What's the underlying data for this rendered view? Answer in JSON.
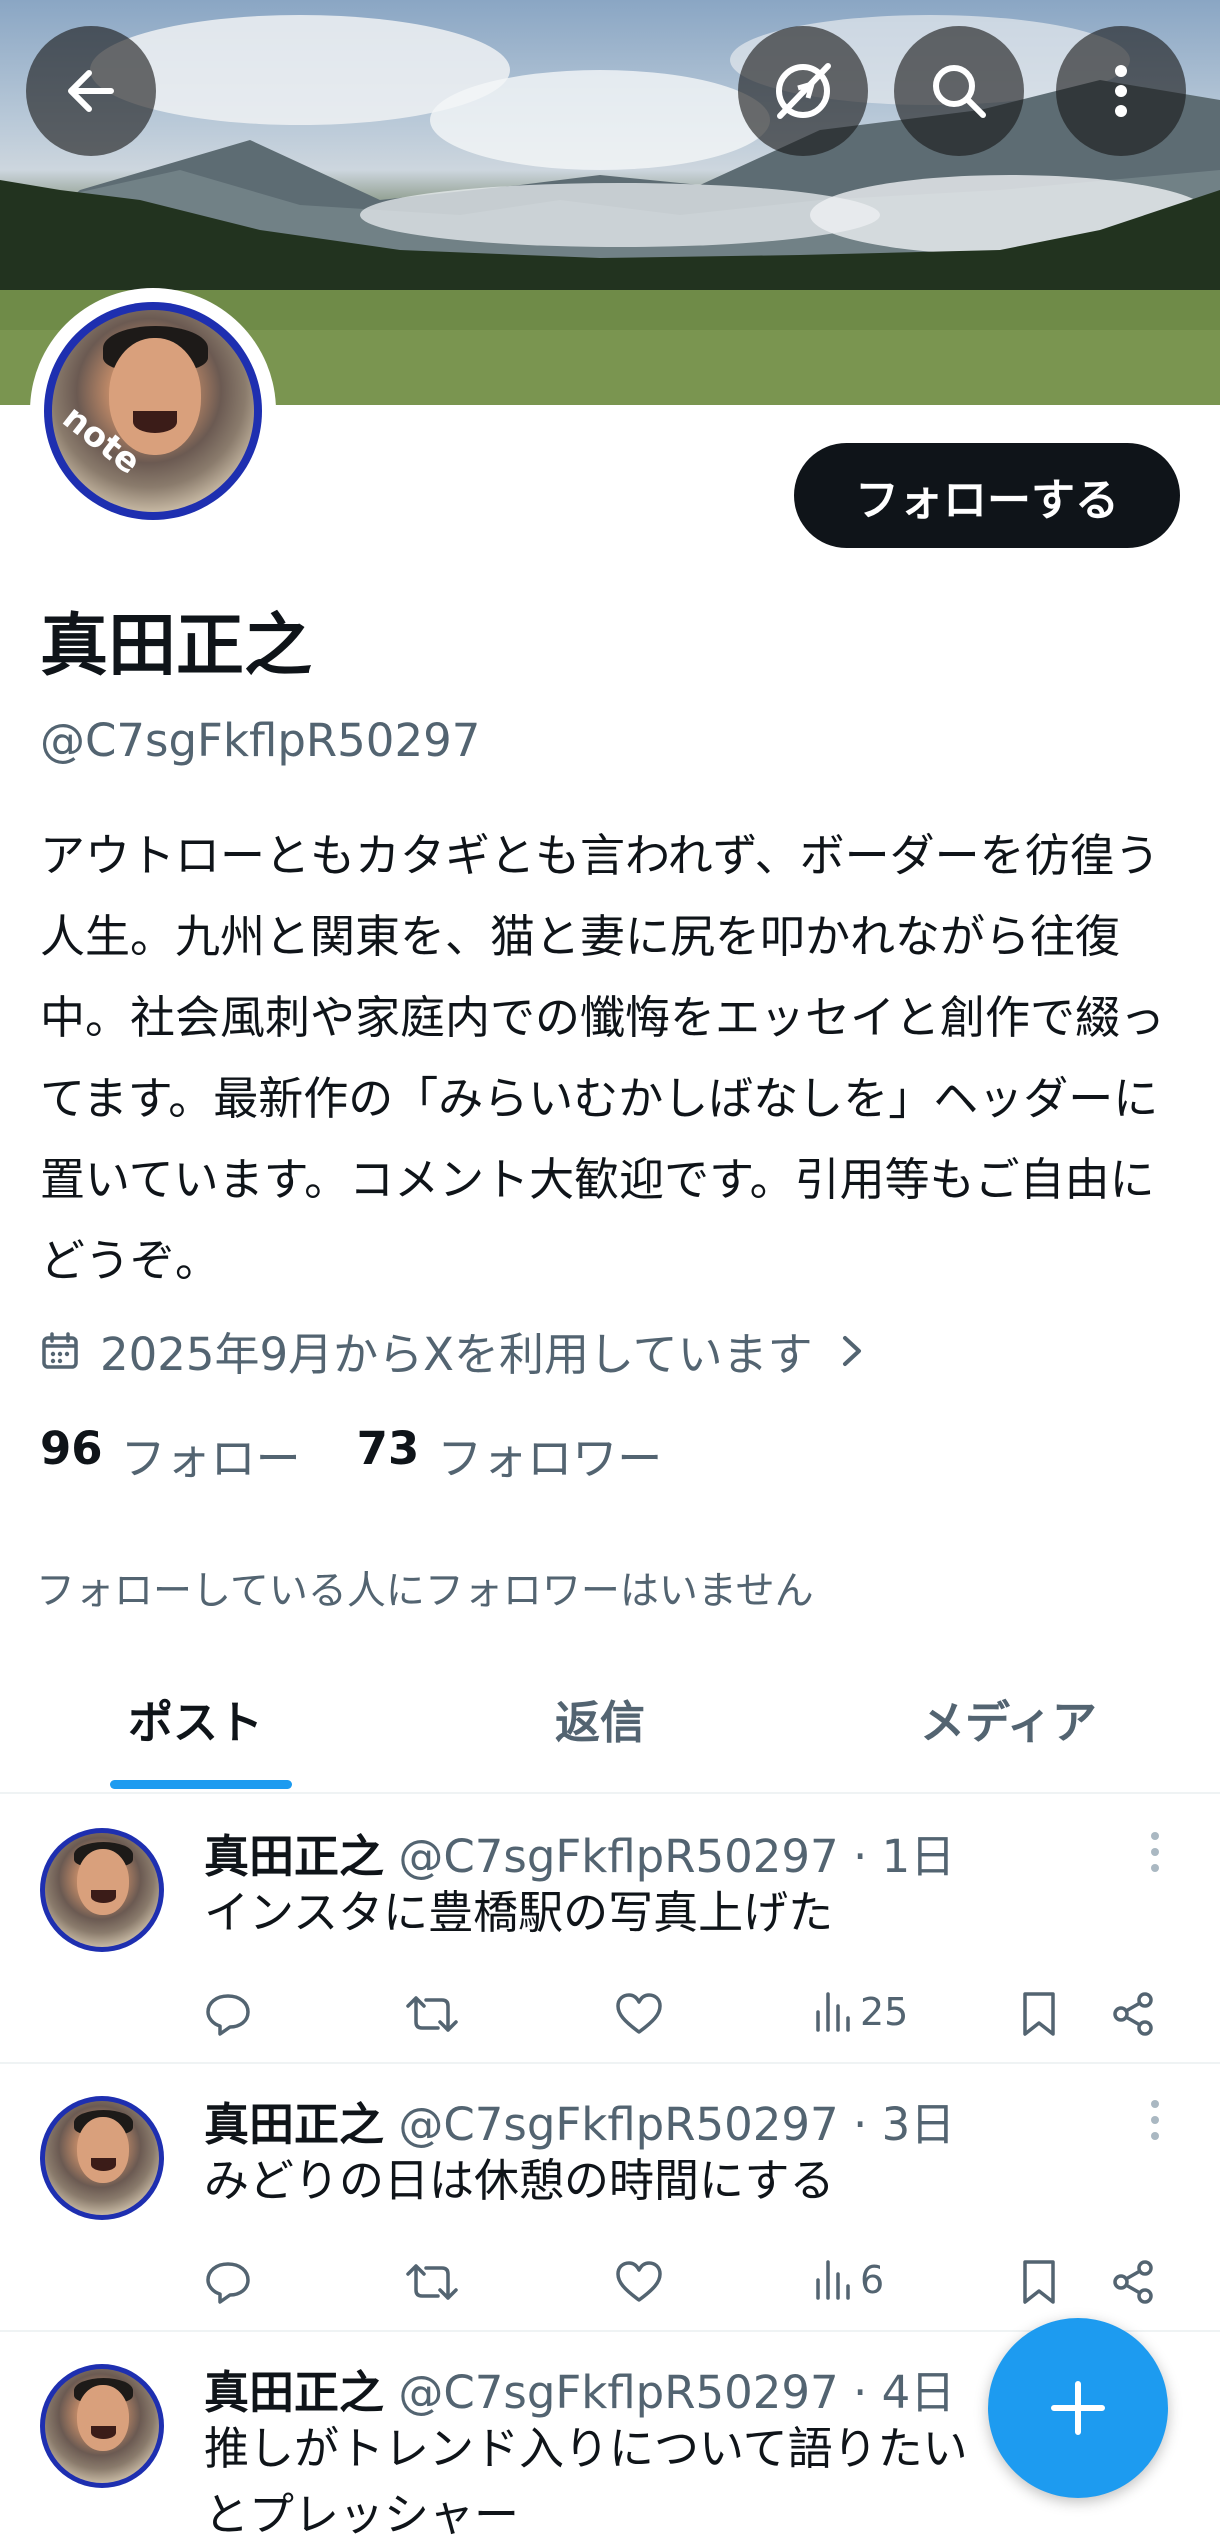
{
  "header": {
    "back_icon": "arrow-left-icon",
    "grok_icon": "grok-icon",
    "search_icon": "search-icon",
    "more_icon": "more-vertical-icon"
  },
  "profile": {
    "avatar_label": "note",
    "name": "真田正之",
    "handle": "@C7sgFkflpR50297",
    "follow_label": "フォローする",
    "bio": "アウトローともカタギとも言われず、ボーダーを彷徨う人生。九州と関東を、猫と妻に尻を叩かれながら往復中。社会風刺や家庭内での懺悔をエッセイと創作で綴ってます。最新作の「みらいむかしばなしを」ヘッダーに置いています。コメント大歓迎です。引用等もご自由にどうぞ。",
    "joined": "2025年9月からXを利用しています",
    "following_count": "96",
    "following_label": "フォロー",
    "followers_count": "73",
    "followers_label": "フォロワー",
    "mutual_note": "フォローしている人にフォロワーはいません"
  },
  "tabs": [
    {
      "label": "ポスト",
      "active": true
    },
    {
      "label": "返信",
      "active": false
    },
    {
      "label": "メディア",
      "active": false
    }
  ],
  "posts": [
    {
      "name": "真田正之",
      "meta": "@C7sgFkflpR50297 · 1日",
      "text": "インスタに豊橋駅の写真上げた",
      "views": "25"
    },
    {
      "name": "真田正之",
      "meta": "@C7sgFkflpR50297 · 3日",
      "text": "みどりの日は休憩の時間にする",
      "views": "6"
    },
    {
      "name": "真田正之",
      "meta": "@C7sgFkflpR50297 · 4日",
      "text": "推しがトレンド入りについて語りたい\nとプレッシャー",
      "views": ""
    }
  ],
  "colors": {
    "accent": "#1d9bf0",
    "text_primary": "#0f1419",
    "text_secondary": "#536471"
  }
}
